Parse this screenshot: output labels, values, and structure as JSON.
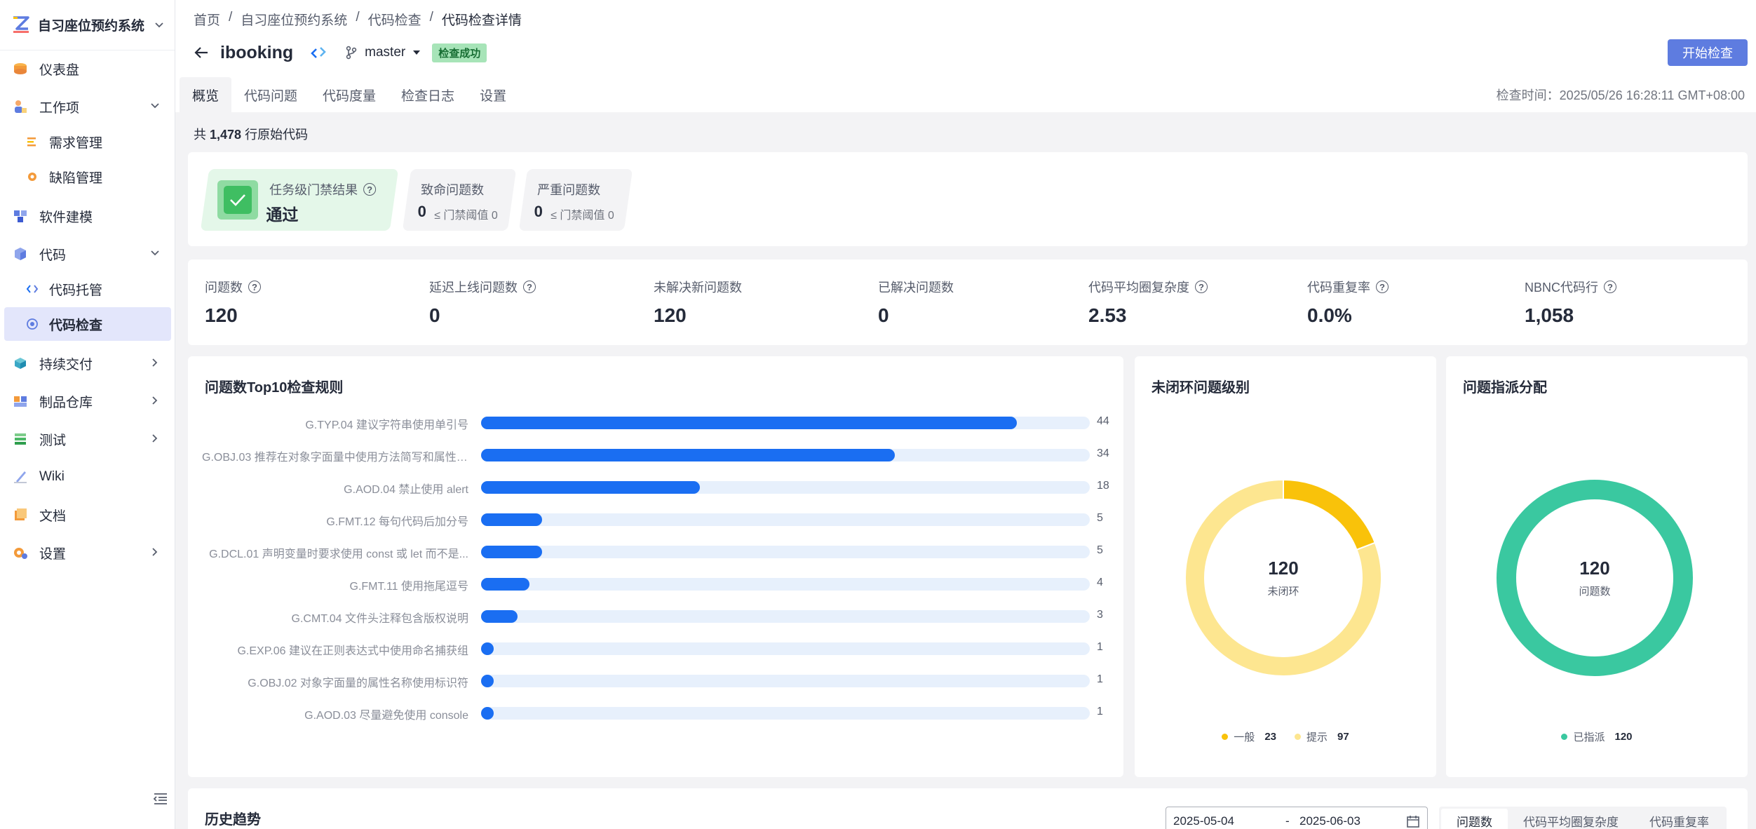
{
  "sidebar": {
    "title": "自习座位预约系统",
    "items": [
      {
        "label": "仪表盘"
      },
      {
        "label": "工作项"
      },
      {
        "label": "需求管理"
      },
      {
        "label": "缺陷管理"
      },
      {
        "label": "软件建模"
      },
      {
        "label": "代码"
      },
      {
        "label": "代码托管"
      },
      {
        "label": "代码检查"
      },
      {
        "label": "持续交付"
      },
      {
        "label": "制品仓库"
      },
      {
        "label": "测试"
      },
      {
        "label": "Wiki"
      },
      {
        "label": "文档"
      },
      {
        "label": "设置"
      }
    ]
  },
  "breadcrumb": [
    "首页",
    "/",
    "自习座位预约系统",
    "/",
    "代码检查",
    "/",
    "代码检查详情"
  ],
  "header": {
    "repo_name": "ibooking",
    "branch": "master",
    "status": "检查成功",
    "start_button": "开始检查",
    "check_time": "检查时间：2025/05/26 16:28:11 GMT+08:00"
  },
  "tabs": [
    "概览",
    "代码问题",
    "代码度量",
    "检查日志",
    "设置"
  ],
  "summary": {
    "prefix": "共",
    "lines": "1,478",
    "suffix": "行原始代码"
  },
  "gate": {
    "label": "任务级门禁结果",
    "value": "通过",
    "fatal_label": "致命问题数",
    "fatal_value": "0",
    "fatal_threshold": "≤ 门禁阈值 0",
    "severe_label": "严重问题数",
    "severe_value": "0",
    "severe_threshold": "≤ 门禁阈值 0"
  },
  "metrics": [
    {
      "label": "问题数",
      "value": "120",
      "help": true
    },
    {
      "label": "延迟上线问题数",
      "value": "0",
      "help": true
    },
    {
      "label": "未解决新问题数",
      "value": "120",
      "help": false
    },
    {
      "label": "已解决问题数",
      "value": "0",
      "help": false
    },
    {
      "label": "代码平均圈复杂度",
      "value": "2.53",
      "help": true
    },
    {
      "label": "代码重复率",
      "value": "0.0%",
      "help": true
    },
    {
      "label": "NBNC代码行",
      "value": "1,058",
      "help": true
    }
  ],
  "top10": {
    "title": "问题数Top10检查规则",
    "max": 44,
    "rules": [
      {
        "label": "G.TYP.04 建议字符串使用单引号",
        "value": 44
      },
      {
        "label": "G.OBJ.03 推荐在对象字面量中使用方法简写和属性简写",
        "value": 34
      },
      {
        "label": "G.AOD.04 禁止使用 alert",
        "value": 18
      },
      {
        "label": "G.FMT.12 每句代码后加分号",
        "value": 5
      },
      {
        "label": "G.DCL.01 声明变量时要求使用 const 或 let 而不是...",
        "value": 5
      },
      {
        "label": "G.FMT.11 使用拖尾逗号",
        "value": 4
      },
      {
        "label": "G.CMT.04 文件头注释包含版权说明",
        "value": 3
      },
      {
        "label": "G.EXP.06 建议在正则表达式中使用命名捕获组",
        "value": 1
      },
      {
        "label": "G.OBJ.02 对象字面量的属性名称使用标识符",
        "value": 1
      },
      {
        "label": "G.AOD.03 尽量避免使用 console",
        "value": 1
      }
    ]
  },
  "level": {
    "title": "未闭环问题级别",
    "total": "120",
    "total_label": "未闭环",
    "segments": [
      {
        "name": "一般",
        "value": 23,
        "color": "#f9c20a"
      },
      {
        "name": "提示",
        "value": 97,
        "color": "#fde690"
      }
    ]
  },
  "assign": {
    "title": "问题指派分配",
    "total": "120",
    "total_label": "问题数",
    "segments": [
      {
        "name": "已指派",
        "value": 120,
        "color": "#3ac8a0"
      }
    ]
  },
  "trend": {
    "title": "历史趋势",
    "date_from": "2025-05-04",
    "date_sep": "-",
    "date_to": "2025-06-03",
    "tabs": [
      "问题数",
      "代码平均圈复杂度",
      "代码重复率"
    ]
  }
}
